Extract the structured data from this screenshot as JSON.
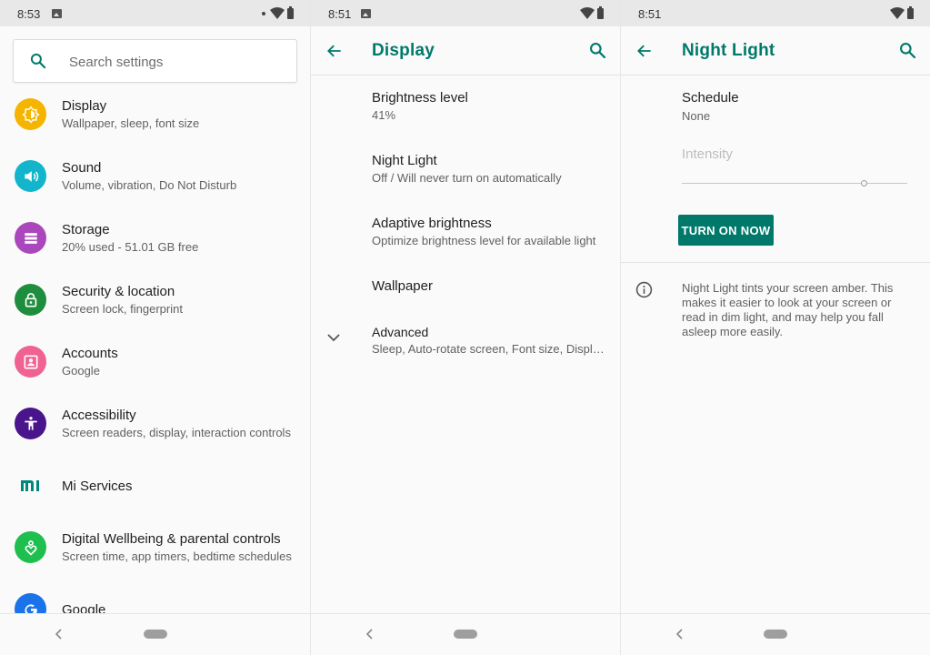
{
  "panels": [
    {
      "status": {
        "time": "8:53"
      }
    },
    {
      "status": {
        "time": "8:51"
      }
    },
    {
      "status": {
        "time": "8:51"
      }
    }
  ],
  "settings": {
    "search_placeholder": "Search settings",
    "items": [
      {
        "title": "Display",
        "subtitle": "Wallpaper, sleep, font size",
        "color": "#f4b400",
        "icon": "display-icon"
      },
      {
        "title": "Sound",
        "subtitle": "Volume, vibration, Do Not Disturb",
        "color": "#12b5cb",
        "icon": "volume-icon"
      },
      {
        "title": "Storage",
        "subtitle": "20% used - 51.01 GB free",
        "color": "#ab47bc",
        "icon": "storage-icon"
      },
      {
        "title": "Security & location",
        "subtitle": "Screen lock, fingerprint",
        "color": "#1e8e3e",
        "icon": "lock-icon"
      },
      {
        "title": "Accounts",
        "subtitle": "Google",
        "color": "#f06292",
        "icon": "account-icon"
      },
      {
        "title": "Accessibility",
        "subtitle": "Screen readers, display, interaction controls",
        "color": "#4a148c",
        "icon": "accessibility-icon"
      },
      {
        "title": "Mi Services",
        "subtitle": "",
        "color": "#00897b",
        "icon": "mi-logo-icon"
      },
      {
        "title": "Digital Wellbeing & parental controls",
        "subtitle": "Screen time, app timers, bedtime schedules",
        "color": "#1fbf4f",
        "icon": "wellbeing-icon"
      },
      {
        "title": "Google",
        "subtitle": "",
        "color": "#1a73e8",
        "icon": "google-icon"
      }
    ]
  },
  "display": {
    "title": "Display",
    "items": [
      {
        "title": "Brightness level",
        "subtitle": "41%"
      },
      {
        "title": "Night Light",
        "subtitle": "Off / Will never turn on automatically"
      },
      {
        "title": "Adaptive brightness",
        "subtitle": "Optimize brightness level for available light"
      },
      {
        "title": "Wallpaper",
        "subtitle": ""
      },
      {
        "title": "Advanced",
        "subtitle": "Sleep, Auto-rotate screen, Font size, Display size"
      }
    ]
  },
  "night_light": {
    "title": "Night Light",
    "schedule_label": "Schedule",
    "schedule_value": "None",
    "intensity_label": "Intensity",
    "intensity_level": 0.82,
    "button_label": "TURN ON NOW",
    "info_text": "Night Light tints your screen amber. This makes it easier to look at your screen or read in dim light, and may help you fall asleep more easily."
  },
  "colors": {
    "accent": "#00796b",
    "status_bar": "#e8e8e8"
  }
}
